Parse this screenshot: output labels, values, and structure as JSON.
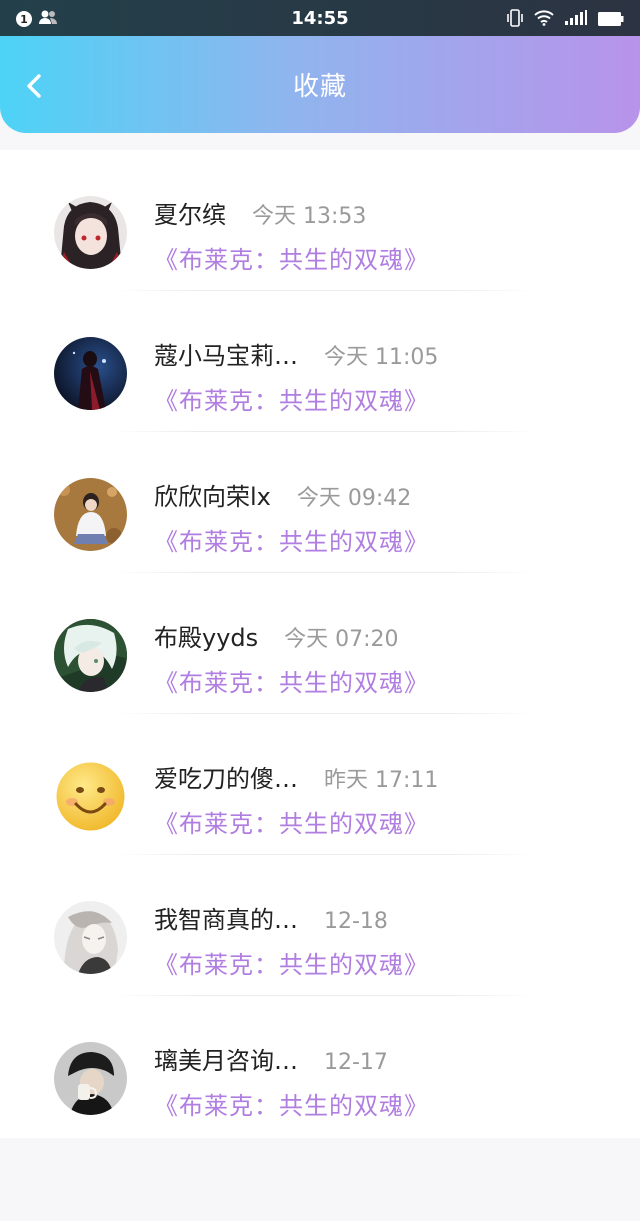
{
  "status_bar": {
    "notification_count": "1",
    "time": "14:55"
  },
  "header": {
    "title": "收藏"
  },
  "accent_color": "#b07de0",
  "items": [
    {
      "name": "夏尔缤",
      "time": "今天 13:53",
      "book": "《布莱克：共生的双魂》"
    },
    {
      "name": "蔻小马宝莉…",
      "time": "今天 11:05",
      "book": "《布莱克：共生的双魂》"
    },
    {
      "name": "欣欣向荣lx",
      "time": "今天 09:42",
      "book": "《布莱克：共生的双魂》"
    },
    {
      "name": "布殿yyds",
      "time": "今天 07:20",
      "book": "《布莱克：共生的双魂》"
    },
    {
      "name": "爱吃刀的傻…",
      "time": "昨天 17:11",
      "book": "《布莱克：共生的双魂》"
    },
    {
      "name": "我智商真的…",
      "time": "12-18",
      "book": "《布莱克：共生的双魂》"
    },
    {
      "name": "璃美月咨询…",
      "time": "12-17",
      "book": "《布莱克：共生的双魂》"
    }
  ]
}
